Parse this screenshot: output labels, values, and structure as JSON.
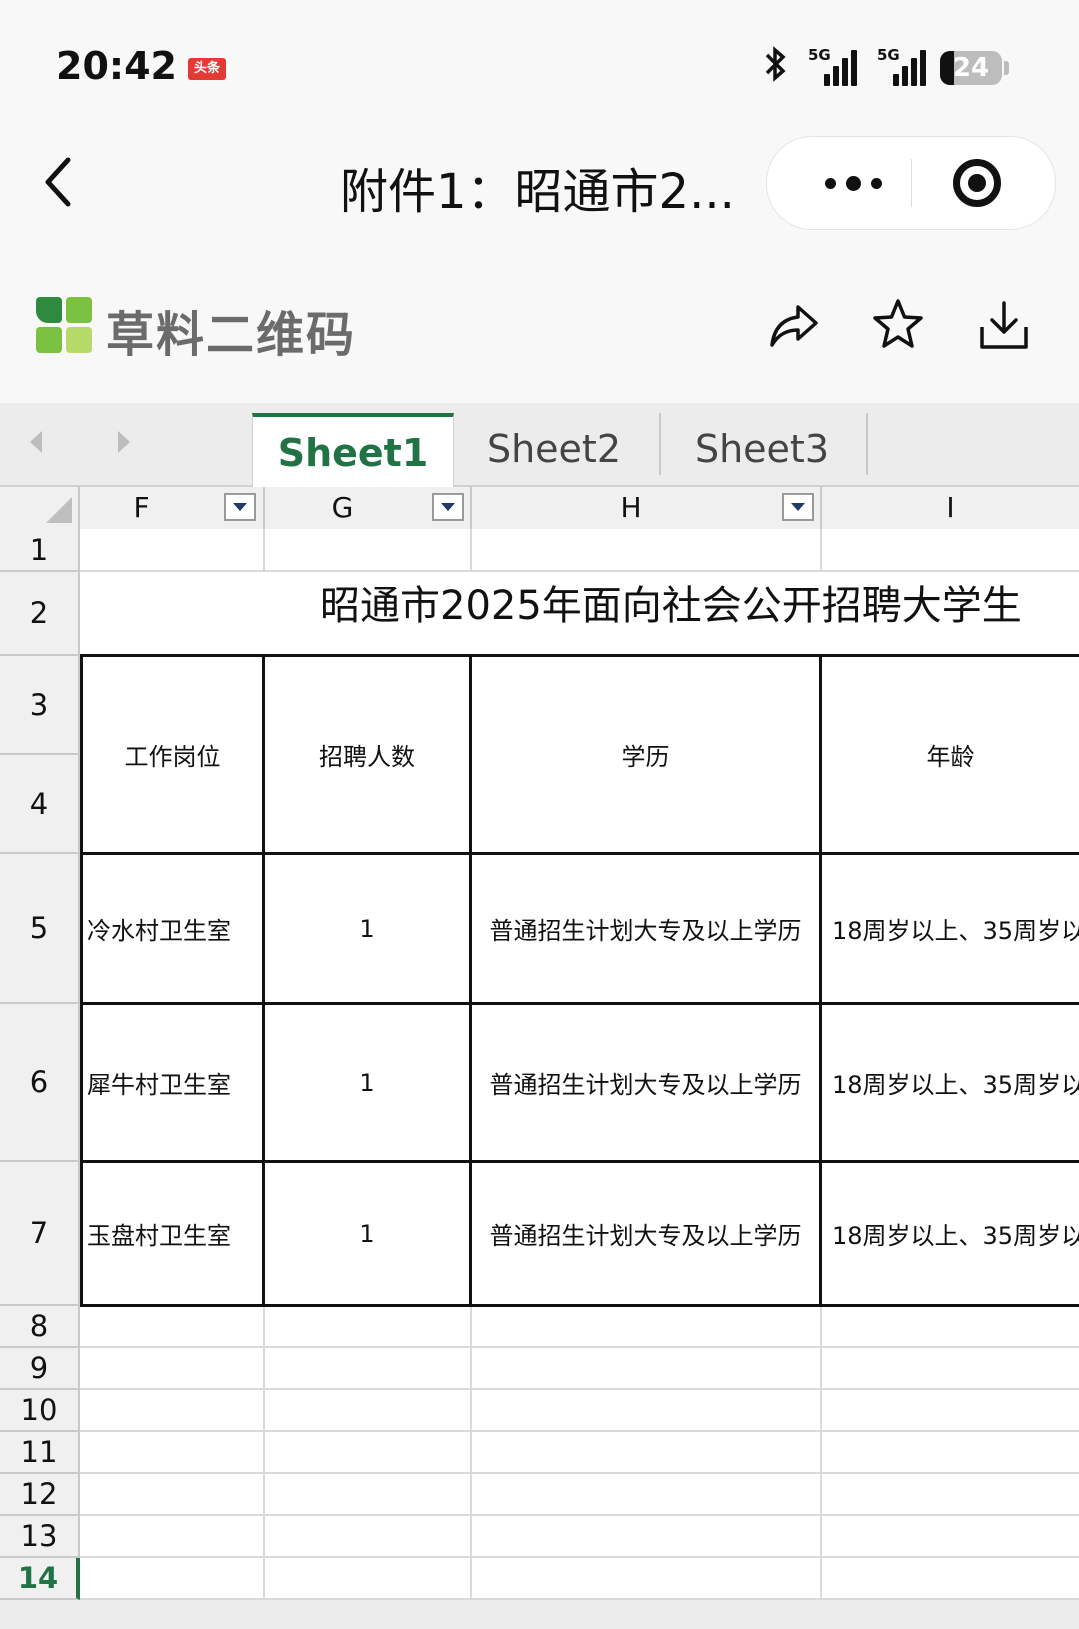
{
  "status_bar": {
    "time": "20:42",
    "news_badge": "头条",
    "signal1_label": "5G",
    "signal2_label": "5G",
    "battery": "24"
  },
  "nav": {
    "title": "附件1：昭通市2...",
    "back_icon": "chevron-left-icon",
    "more_icon": "more-dots-icon",
    "close_icon": "target-close-icon"
  },
  "brand": {
    "name": "草料二维码",
    "logo_colors": [
      "#2e8b3e",
      "#7cc242",
      "#7cc242",
      "#b6d96a"
    ],
    "tools": [
      "share-icon",
      "star-icon",
      "download-icon"
    ]
  },
  "sheet_tabs": {
    "tabs": [
      "Sheet1",
      "Sheet2",
      "Sheet3"
    ],
    "active": "Sheet1",
    "accent": "#217346"
  },
  "columns": [
    "F",
    "G",
    "H",
    "I"
  ],
  "rows": [
    "1",
    "2",
    "3",
    "4",
    "5",
    "6",
    "7",
    "8",
    "9",
    "10",
    "11",
    "12",
    "13",
    "14"
  ],
  "sheet": {
    "title_text": "昭通市2025年面向社会公开招聘大学生",
    "headers": [
      "工作岗位",
      "招聘人数",
      "学历",
      "年龄"
    ],
    "data": [
      [
        "冷水村卫生室",
        "1",
        "普通招生计划大专及以上学历",
        "18周岁以上、35周岁以"
      ],
      [
        "犀牛村卫生室",
        "1",
        "普通招生计划大专及以上学历",
        "18周岁以上、35周岁以"
      ],
      [
        "玉盘村卫生室",
        "1",
        "普通招生计划大专及以上学历",
        "18周岁以上、35周岁以"
      ]
    ]
  }
}
